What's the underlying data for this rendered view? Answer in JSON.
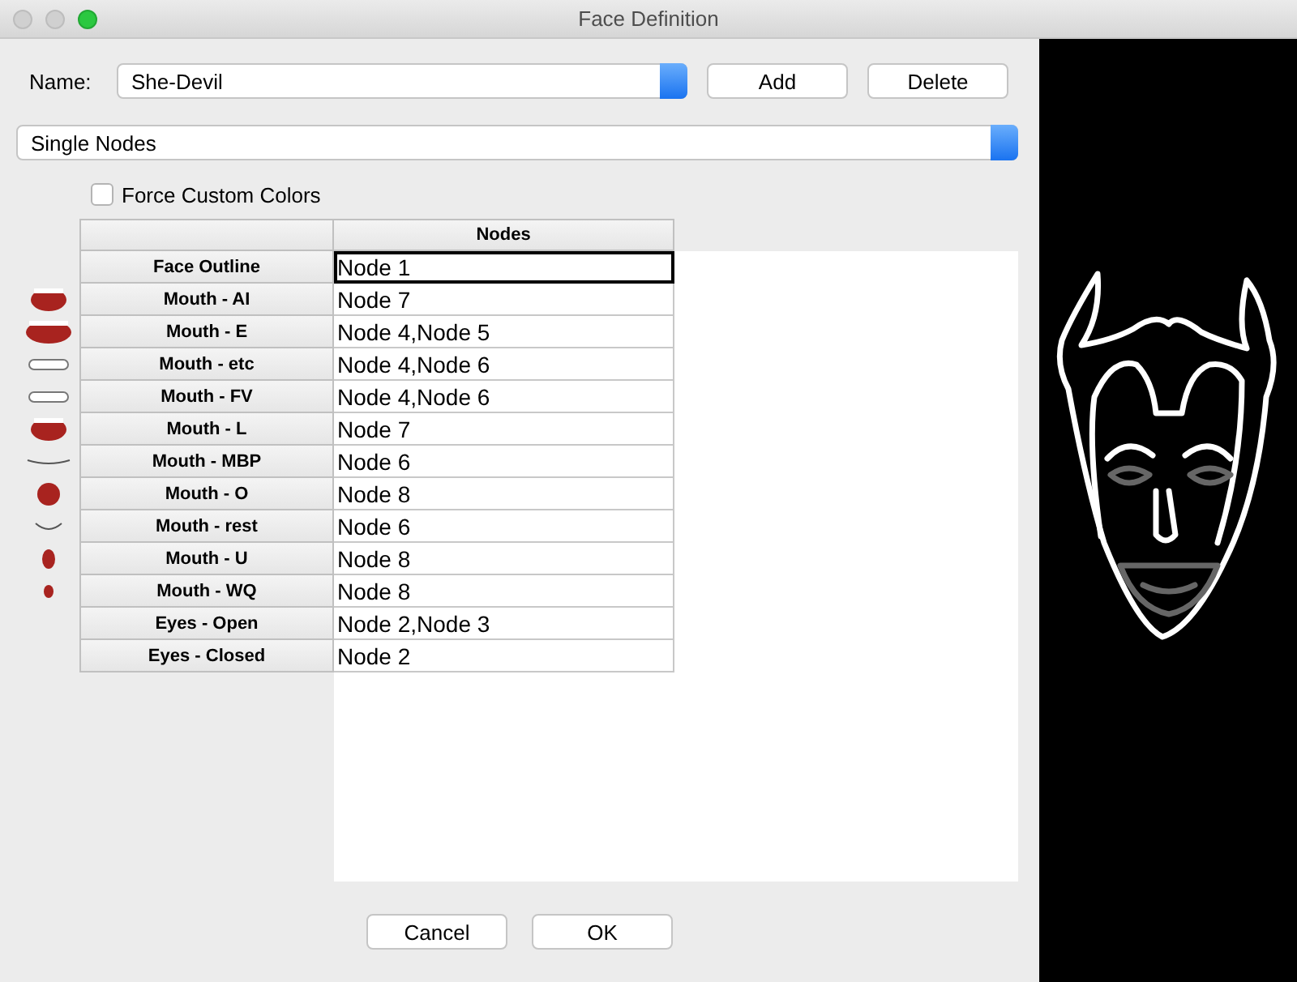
{
  "window": {
    "title": "Face Definition"
  },
  "name_field": {
    "label": "Name:",
    "value": "She-Devil"
  },
  "buttons_top": [
    "Add",
    "Delete"
  ],
  "mode_select": {
    "value": "Single Nodes"
  },
  "force_custom_colors": {
    "label": "Force Custom Colors",
    "checked": false
  },
  "table": {
    "columns": [
      "Nodes"
    ],
    "rows": [
      {
        "label": "Face Outline",
        "nodes": "Node 1",
        "kind": "outline",
        "selected": true
      },
      {
        "label": "Mouth - AI",
        "nodes": "Node 7",
        "kind": "mouth",
        "selected": false
      },
      {
        "label": "Mouth - E",
        "nodes": "Node 4,Node 5",
        "kind": "mouth",
        "selected": false
      },
      {
        "label": "Mouth - etc",
        "nodes": "Node 4,Node 6",
        "kind": "mouth",
        "selected": false
      },
      {
        "label": "Mouth - FV",
        "nodes": "Node 4,Node 6",
        "kind": "mouth",
        "selected": false
      },
      {
        "label": "Mouth - L",
        "nodes": "Node 7",
        "kind": "mouth",
        "selected": false
      },
      {
        "label": "Mouth - MBP",
        "nodes": "Node 6",
        "kind": "mouth",
        "selected": false
      },
      {
        "label": "Mouth - O",
        "nodes": "Node 8",
        "kind": "mouth",
        "selected": false
      },
      {
        "label": "Mouth - rest",
        "nodes": "Node 6",
        "kind": "mouth",
        "selected": false
      },
      {
        "label": "Mouth - U",
        "nodes": "Node 8",
        "kind": "mouth",
        "selected": false
      },
      {
        "label": "Mouth - WQ",
        "nodes": "Node 8",
        "kind": "mouth",
        "selected": false
      },
      {
        "label": "Eyes - Open",
        "nodes": "Node 2,Node 3",
        "kind": "eyes",
        "selected": false
      },
      {
        "label": "Eyes - Closed",
        "nodes": "Node 2",
        "kind": "eyes",
        "selected": false
      }
    ]
  },
  "buttons_bottom": [
    "Cancel",
    "OK"
  ]
}
